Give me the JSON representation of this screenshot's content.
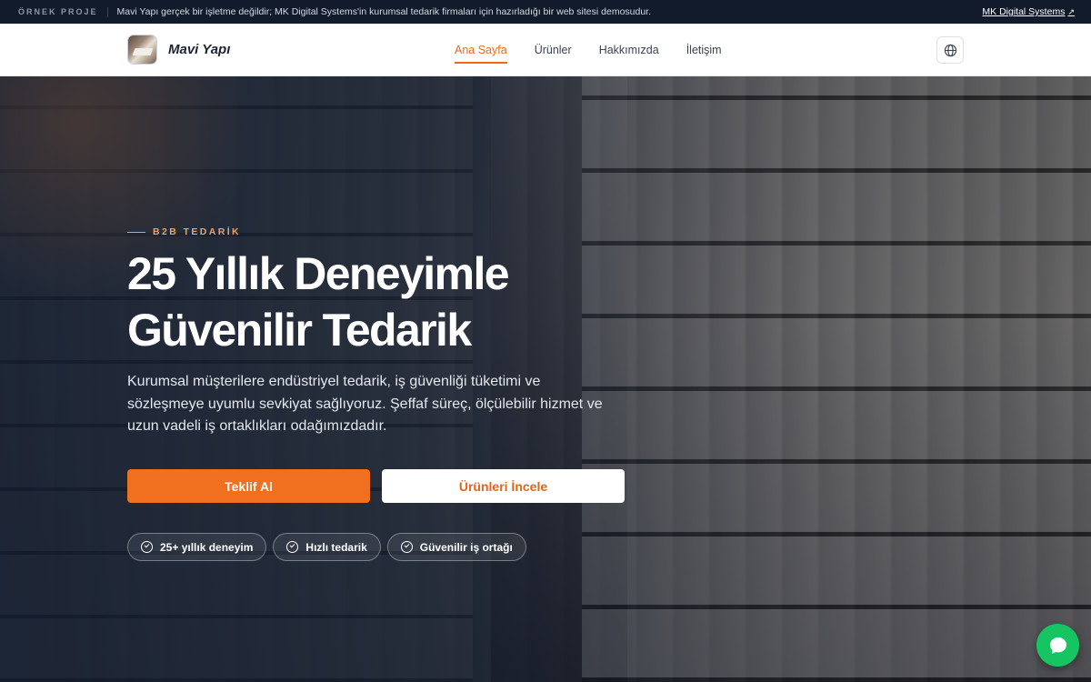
{
  "topbar": {
    "tag": "ÖRNEK PROJE",
    "message": "Mavi Yapı gerçek bir işletme değildir; MK Digital Systems'in kurumsal tedarik firmaları için hazırladığı bir web sitesi demosudur.",
    "link_label": "MK Digital Systems",
    "link_icon": "external-arrow-icon"
  },
  "header": {
    "brand": "Mavi Yapı",
    "nav": [
      {
        "label": "Ana Sayfa",
        "active": true
      },
      {
        "label": "Ürünler",
        "active": false
      },
      {
        "label": "Hakkımızda",
        "active": false
      },
      {
        "label": "İletişim",
        "active": false
      }
    ],
    "language_icon": "globe-icon"
  },
  "hero": {
    "eyebrow": "B2B TEDARİK",
    "title_line1": "25 Yıllık Deneyimle",
    "title_line2": "Güvenilir Tedarik",
    "lead": "Kurumsal müşterilere endüstriyel tedarik, iş güvenliği tüketimi ve sözleşmeye uyumlu sevkiyat sağlıyoruz. Şeffaf süreç, ölçülebilir hizmet ve uzun vadeli iş ortaklıkları odağımızdadır.",
    "primary_cta": "Teklif Al",
    "secondary_cta": "Ürünleri İncele",
    "badges": [
      "25+ yıllık deneyim",
      "Hızlı tedarik",
      "Güvenilir iş ortağı"
    ]
  },
  "chat": {
    "icon": "chat-bubble-icon"
  },
  "colors": {
    "accent": "#f0701f",
    "navy": "#111b2b",
    "chat": "#16c562"
  }
}
